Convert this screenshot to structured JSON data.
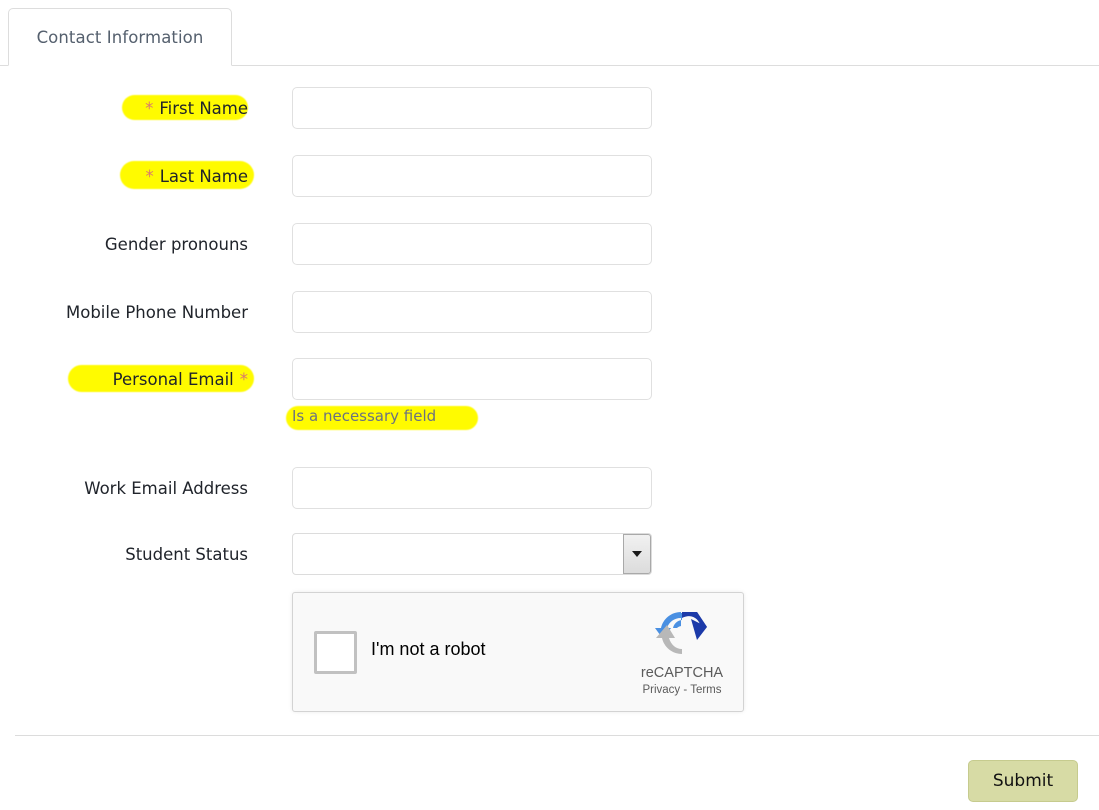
{
  "tab": {
    "label": "Contact Information"
  },
  "form": {
    "fields": [
      {
        "id": "first-name",
        "label": "First Name",
        "required_marker": "*",
        "marker_position": "before",
        "value": "",
        "placeholder": "",
        "type": "text",
        "highlighted": true
      },
      {
        "id": "last-name",
        "label": "Last Name",
        "required_marker": "*",
        "marker_position": "before",
        "value": "",
        "placeholder": "",
        "type": "text",
        "highlighted": true
      },
      {
        "id": "gender-pronouns",
        "label": "Gender pronouns",
        "required_marker": "",
        "marker_position": "none",
        "value": "",
        "placeholder": "",
        "type": "text",
        "highlighted": false
      },
      {
        "id": "mobile-phone-number",
        "label": "Mobile Phone Number",
        "required_marker": "",
        "marker_position": "none",
        "value": "",
        "placeholder": "",
        "type": "text",
        "highlighted": false
      },
      {
        "id": "personal-email",
        "label": "Personal Email",
        "required_marker": "*",
        "marker_position": "after",
        "value": "",
        "placeholder": "",
        "type": "text",
        "highlighted": true,
        "helper_text": "Is a necessary field",
        "helper_highlighted": true
      },
      {
        "id": "work-email-address",
        "label": "Work Email Address",
        "required_marker": "",
        "marker_position": "none",
        "value": "",
        "placeholder": "",
        "type": "text",
        "highlighted": false
      },
      {
        "id": "student-status",
        "label": "Student Status",
        "required_marker": "",
        "marker_position": "none",
        "value": "",
        "placeholder": "",
        "type": "select",
        "highlighted": false
      }
    ]
  },
  "recaptcha": {
    "checkbox_label": "I'm not a robot",
    "brand": "reCAPTCHA",
    "legal": "Privacy - Terms",
    "checked": false,
    "logo_icon": "recaptcha-logo-icon"
  },
  "footer": {
    "submit_label": "Submit"
  },
  "colors": {
    "highlight": "#fffb00",
    "asterisk": "#d9786f",
    "submit_bg": "#d7dba5",
    "tab_text": "#55606e",
    "helper_text": "#6b7280",
    "recaptcha_blue_light": "#4a90e2",
    "recaptcha_blue_dark": "#1c3aa9",
    "recaptcha_gray": "#b8b8b8"
  }
}
